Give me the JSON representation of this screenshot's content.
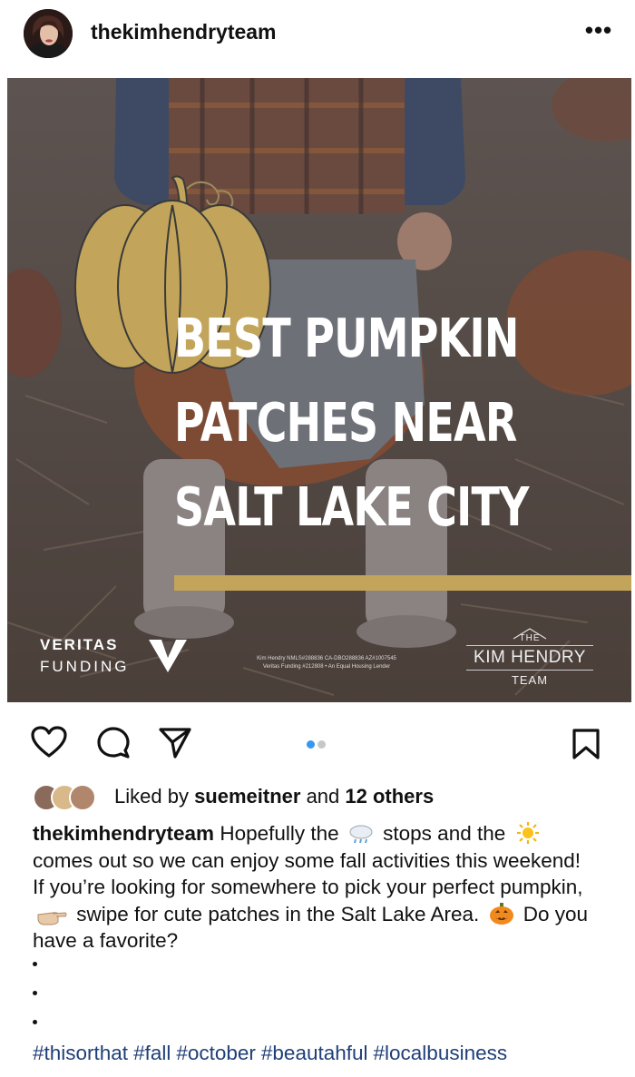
{
  "post": {
    "username": "thekimhendryteam",
    "more_label": "•••",
    "image": {
      "headline": [
        "BEST PUMPKIN",
        "PATCHES NEAR",
        "SALT LAKE CITY"
      ],
      "veritas_line1": "VERITAS",
      "veritas_line2": "FUNDING",
      "fineprint_line1": "Kim Hendry NMLS#288836 CA-DBO288836 AZ#1007545",
      "fineprint_line2": "Veritas Funding #212808 • An Equal Housing Lender",
      "team_the": "THE",
      "team_name": "KIM HENDRY",
      "team_word": "TEAM",
      "accent_color": "#c2a55a"
    },
    "carousel": {
      "count": 2,
      "active": 1,
      "active_color": "#3897f0",
      "inactive_color": "#c7c7c7"
    }
  },
  "likes": {
    "prefix": "Liked by ",
    "user": "suemeitner",
    "middle": " and ",
    "others": "12 others"
  },
  "caption": {
    "user": "thekimhendryteam",
    "part1": " Hopefully the ",
    "part2": " stops and the ",
    "part3": " comes out so we can enjoy some fall activities this weekend! If you’re looking for somewhere to pick your perfect pumpkin, ",
    "part4": " swipe for cute patches in the Salt Lake Area. ",
    "part5": " Do you have a favorite?",
    "emoji_icons": [
      "rain-cloud-icon",
      "sun-icon",
      "pointing-hand-icon",
      "jack-o-lantern-icon"
    ]
  },
  "hashtags": [
    "#thisorthat",
    "#fall",
    "#october",
    "#beautahful",
    "#localbusiness"
  ]
}
